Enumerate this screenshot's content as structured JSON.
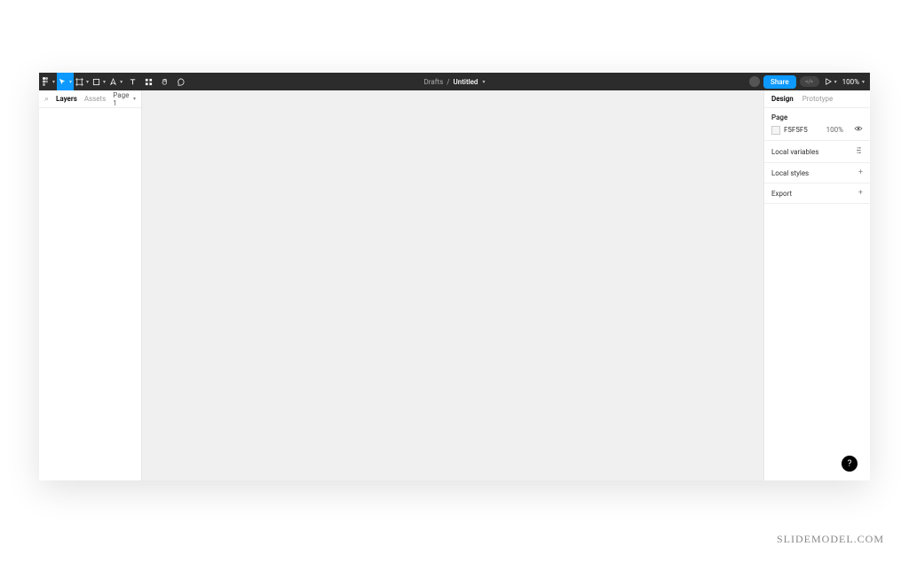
{
  "toolbar": {
    "center": {
      "folder": "Drafts",
      "separator": "/",
      "title": "Untitled"
    },
    "share_label": "Share",
    "zoom_label": "100%"
  },
  "left_panel": {
    "tabs": {
      "layers": "Layers",
      "assets": "Assets"
    },
    "page_label": "Page 1"
  },
  "right_panel": {
    "tabs": {
      "design": "Design",
      "prototype": "Prototype"
    },
    "page_section": {
      "title": "Page",
      "bg_hex": "F5F5F5",
      "bg_opacity": "100%"
    },
    "local_variables": "Local variables",
    "local_styles": "Local styles",
    "export": "Export"
  },
  "help_label": "?",
  "watermark": "SLIDEMODEL.COM"
}
